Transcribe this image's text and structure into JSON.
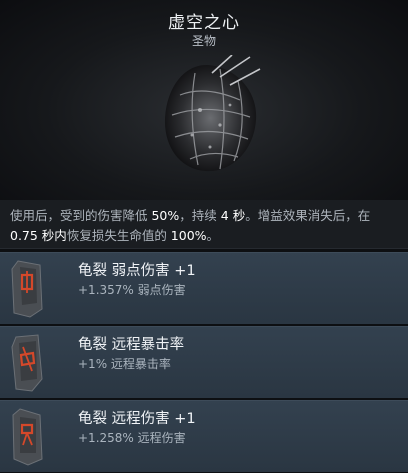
{
  "item": {
    "name": "虚空之心",
    "category": "圣物",
    "icon": "void-heart-relic-icon"
  },
  "description": {
    "part1": "使用后，受到的伤害降低 ",
    "value1": "50%",
    "part2": "，持续 ",
    "value2": "4 秒",
    "part3": "。增益效果消失后，在 ",
    "value3": "0.75 秒内",
    "part4": "恢复损失生命值的 ",
    "value4": "100%",
    "part5": "。"
  },
  "entries": [
    {
      "title": "龟裂 弱点伤害 +1",
      "bonus": "+1.357% 弱点伤害",
      "icon": "rune-stone-icon"
    },
    {
      "title": "龟裂 远程暴击率",
      "bonus": "+1% 远程暴击率",
      "icon": "rune-stone-icon"
    },
    {
      "title": "龟裂 远程伤害 +1",
      "bonus": "+1.258% 远程伤害",
      "icon": "rune-stone-icon"
    }
  ],
  "colors": {
    "rune_glow": "#d4482a",
    "entry_bg": "#2f3c49"
  }
}
